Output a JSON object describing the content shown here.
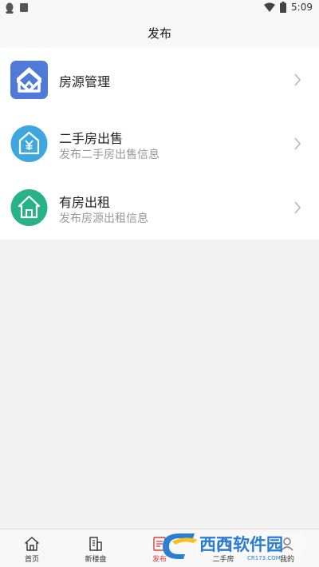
{
  "status_bar": {
    "time": "5:09",
    "left_icons": [
      "qq-icon",
      "notification-icon"
    ],
    "right_icons": [
      "wifi-icon",
      "battery-icon"
    ]
  },
  "header": {
    "title": "发布"
  },
  "menu": {
    "items": [
      {
        "title": "房源管理",
        "subtitle": "",
        "icon": "house-manage-icon",
        "color": "#4f7ad8"
      },
      {
        "title": "二手房出售",
        "subtitle": "发布二手房出售信息",
        "icon": "yen-house-icon",
        "color": "#3fa7e0"
      },
      {
        "title": "有房出租",
        "subtitle": "发布房源出租信息",
        "icon": "house-rent-icon",
        "color": "#27b287"
      }
    ]
  },
  "tabs": [
    {
      "label": "首页",
      "icon": "home-icon"
    },
    {
      "label": "新楼盘",
      "icon": "building-icon"
    },
    {
      "label": "发布",
      "icon": "publish-icon",
      "active": true
    },
    {
      "label": "二手房",
      "icon": "second-house-icon"
    },
    {
      "label": "我的",
      "icon": "profile-icon"
    }
  ],
  "watermark": {
    "text": "西西软件园",
    "url_text": "CR173.COM"
  },
  "colors": {
    "accent": "#e23b3b",
    "background": "#f3f3f3",
    "card": "#ffffff"
  }
}
